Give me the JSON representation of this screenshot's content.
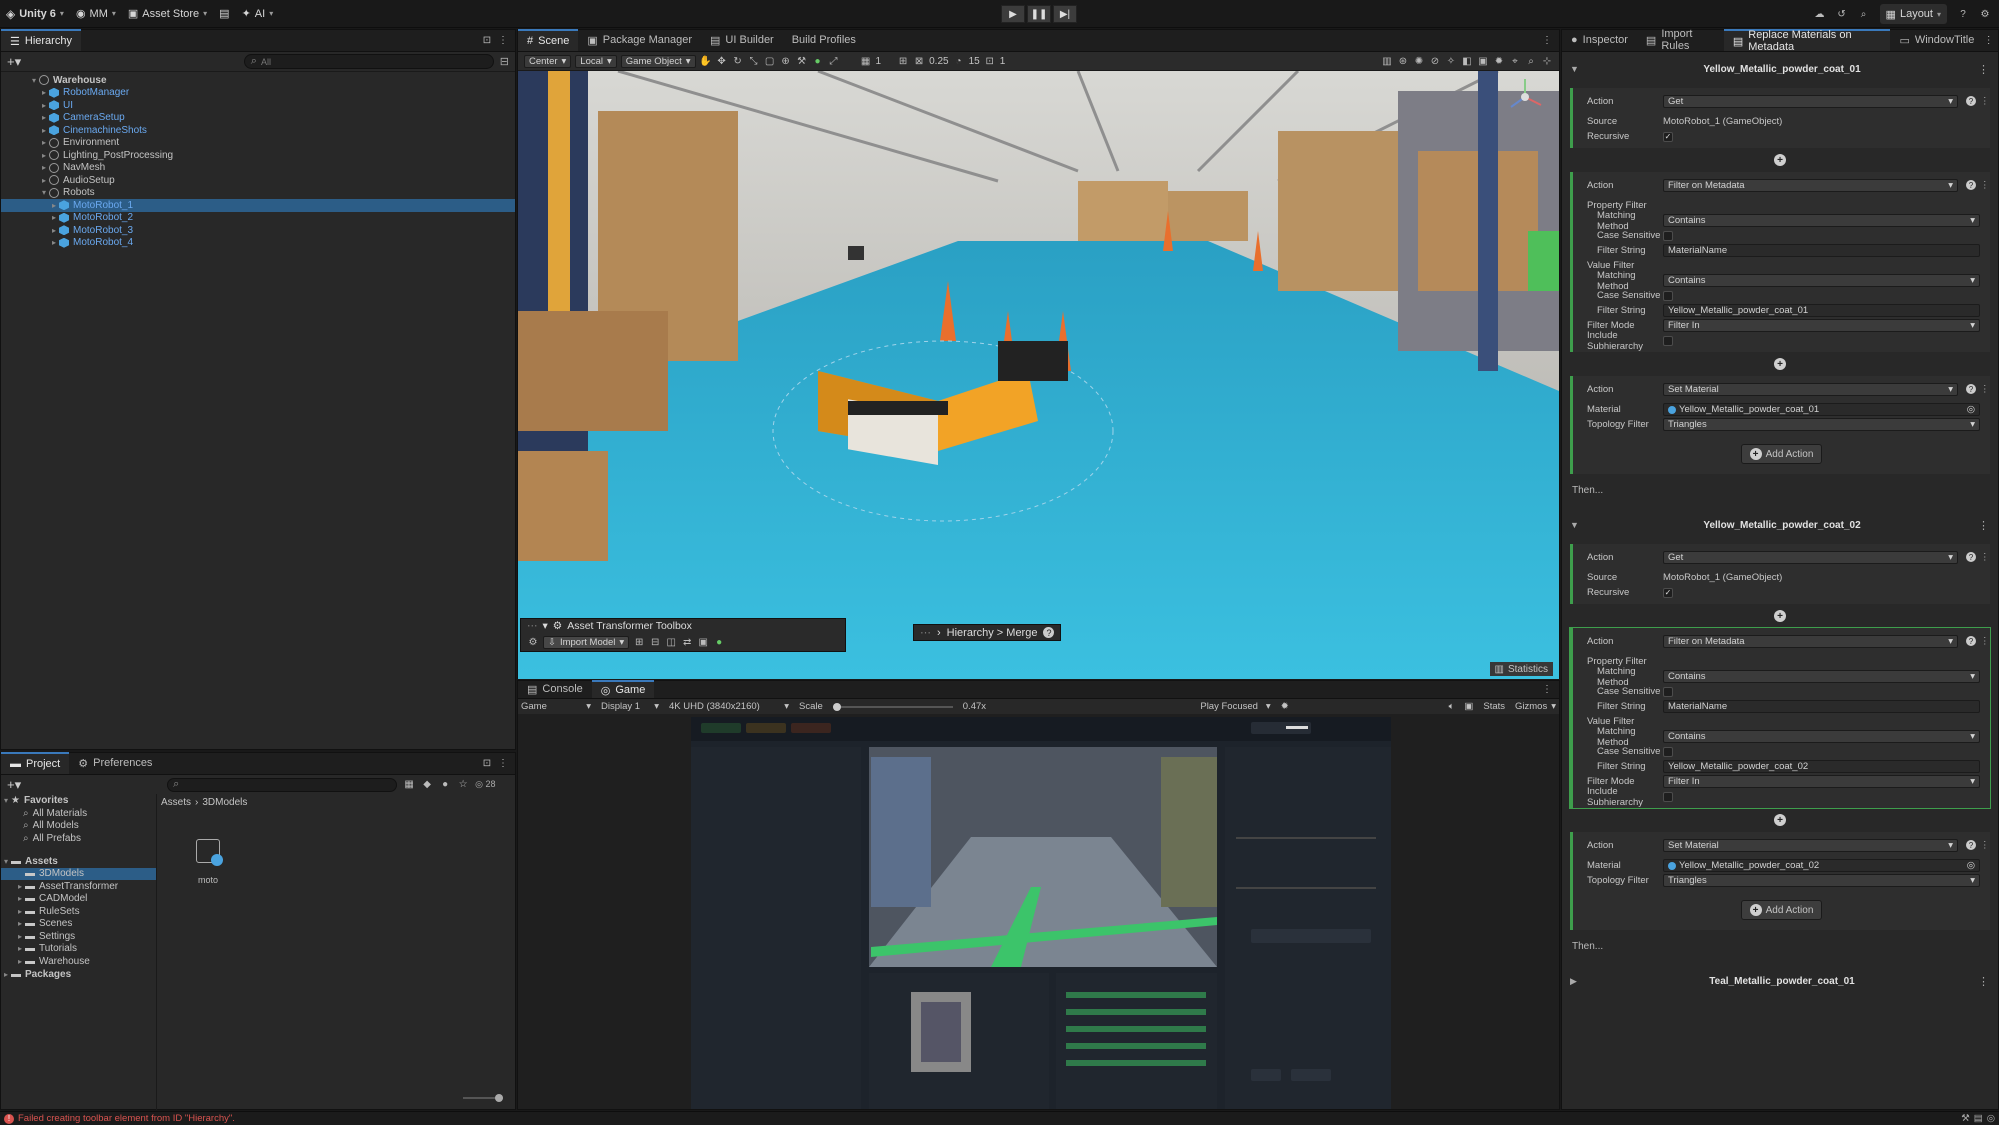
{
  "topbar": {
    "logo": "Unity 6",
    "account": "MM",
    "asset_store": "Asset Store",
    "ai": "AI",
    "layout": "Layout"
  },
  "hierarchy": {
    "tab": "Hierarchy",
    "search_placeholder": "All",
    "items": [
      {
        "label": "Warehouse",
        "indent": 0,
        "icon": "scene-icon",
        "expanded": true,
        "bold": true
      },
      {
        "label": "RobotManager",
        "indent": 1,
        "icon": "prefab-icon",
        "blue": true
      },
      {
        "label": "UI",
        "indent": 1,
        "icon": "prefab-icon",
        "blue": true
      },
      {
        "label": "CameraSetup",
        "indent": 1,
        "icon": "prefab-icon",
        "blue": true
      },
      {
        "label": "CinemachineShots",
        "indent": 1,
        "icon": "prefab-icon",
        "blue": true
      },
      {
        "label": "Environment",
        "indent": 1,
        "icon": "gameobject-icon"
      },
      {
        "label": "Lighting_PostProcessing",
        "indent": 1,
        "icon": "gameobject-icon"
      },
      {
        "label": "NavMesh",
        "indent": 1,
        "icon": "gameobject-icon"
      },
      {
        "label": "AudioSetup",
        "indent": 1,
        "icon": "gameobject-icon"
      },
      {
        "label": "Robots",
        "indent": 1,
        "icon": "gameobject-icon",
        "expanded": true
      },
      {
        "label": "MotoRobot_1",
        "indent": 2,
        "icon": "prefab-icon",
        "blue": true,
        "selected": true
      },
      {
        "label": "MotoRobot_2",
        "indent": 2,
        "icon": "prefab-icon",
        "blue": true
      },
      {
        "label": "MotoRobot_3",
        "indent": 2,
        "icon": "prefab-icon",
        "blue": true
      },
      {
        "label": "MotoRobot_4",
        "indent": 2,
        "icon": "prefab-icon",
        "blue": true
      }
    ]
  },
  "scene": {
    "tabs": [
      "Scene",
      "Package Manager",
      "UI Builder",
      "Build Profiles"
    ],
    "toolbar": {
      "pivot": "Center",
      "space": "Local",
      "mode": "Game Object",
      "grid_value": "1",
      "snap_value": "0.25",
      "angle_value": "15",
      "scale_value": "1"
    },
    "overlay_title": "Asset Transformer Toolbox",
    "import_model": "Import Model",
    "breadcrumb": "Hierarchy > Merge",
    "statistics": "Statistics"
  },
  "game": {
    "tabs": [
      "Console",
      "Game"
    ],
    "display_mode": "Game",
    "display": "Display 1",
    "resolution": "4K UHD (3840x2160)",
    "scale_label": "Scale",
    "scale_value": "0.47x",
    "play_focused": "Play Focused",
    "stats": "Stats",
    "gizmos": "Gizmos",
    "scale_fraction": 0.47
  },
  "project": {
    "tabs": [
      "Project",
      "Preferences"
    ],
    "count": "28",
    "favorites_label": "Favorites",
    "favorites": [
      "All Materials",
      "All Models",
      "All Prefabs"
    ],
    "assets_label": "Assets",
    "folders": [
      "3DModels",
      "AssetTransformer",
      "CADModel",
      "RuleSets",
      "Scenes",
      "Settings",
      "Tutorials",
      "Warehouse"
    ],
    "packages_label": "Packages",
    "breadcrumb_root": "Assets",
    "breadcrumb_leaf": "3DModels",
    "file_name": "moto"
  },
  "inspector": {
    "tabs": [
      "Inspector",
      "Import Rules",
      "Replace Materials on Metadata",
      "WindowTitle"
    ],
    "rules": [
      {
        "title": "Yellow_Metallic_powder_coat_01",
        "get_action": "Get",
        "source": "MotoRobot_1 (GameObject)",
        "filter_action": "Filter on Metadata",
        "prop_method": "Contains",
        "prop_string": "MaterialName",
        "val_method": "Contains",
        "val_string": "Yellow_Metallic_powder_coat_01",
        "filter_mode": "Filter In",
        "set_action": "Set Material",
        "material": "Yellow_Metallic_powder_coat_01",
        "topology": "Triangles"
      },
      {
        "title": "Yellow_Metallic_powder_coat_02",
        "get_action": "Get",
        "source": "MotoRobot_1 (GameObject)",
        "filter_action": "Filter on Metadata",
        "prop_method": "Contains",
        "prop_string": "MaterialName",
        "val_method": "Contains",
        "val_string": "Yellow_Metallic_powder_coat_02",
        "filter_mode": "Filter In",
        "set_action": "Set Material",
        "material": "Yellow_Metallic_powder_coat_02",
        "topology": "Triangles"
      }
    ],
    "collapsed_rule": "Teal_Metallic_powder_coat_01",
    "labels": {
      "action": "Action",
      "source": "Source",
      "recursive": "Recursive",
      "property_filter": "Property Filter",
      "matching_method": "Matching Method",
      "case_sensitive": "Case Sensitive",
      "filter_string": "Filter String",
      "value_filter": "Value Filter",
      "filter_mode": "Filter Mode",
      "include_subhierarchy": "Include Subhierarchy",
      "material": "Material",
      "topology_filter": "Topology Filter",
      "add_action": "Add Action",
      "then": "Then..."
    }
  },
  "status": {
    "error": "Failed creating toolbar element from ID \"Hierarchy\"."
  },
  "colors": {
    "accent_blue": "#3a79bb",
    "active_green": "#3e9e4c",
    "prefab_blue": "#4aa3df",
    "error_red": "#d9534f"
  }
}
